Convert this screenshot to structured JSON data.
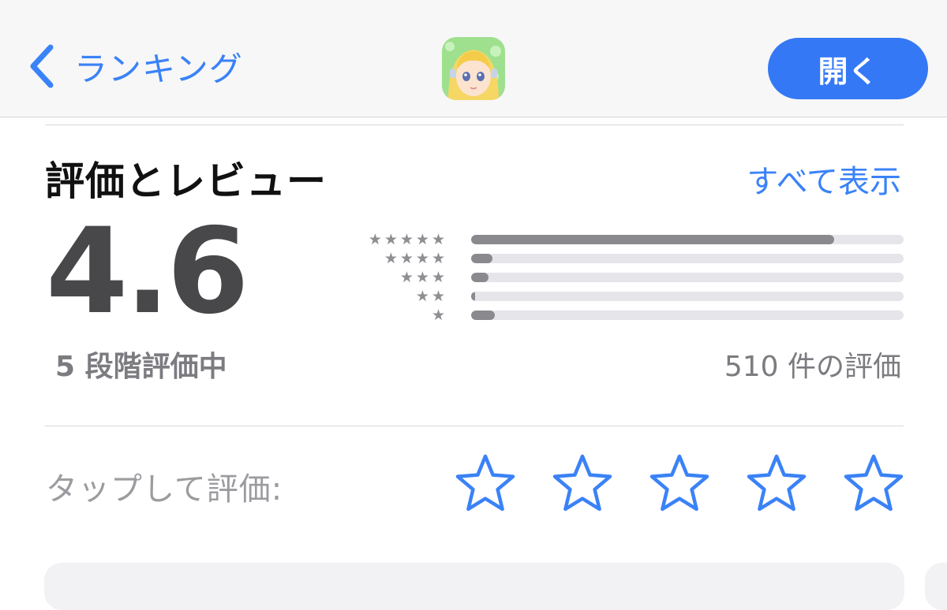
{
  "nav": {
    "back_label": "ランキング",
    "open_label": "開く"
  },
  "section": {
    "title": "評価とレビュー",
    "see_all": "すべて表示"
  },
  "rating": {
    "average": "4.6",
    "out_of": "5 段階評価中",
    "count_text": "510 件の評価",
    "histogram": [
      {
        "stars": "★★★★★",
        "fraction": 0.84
      },
      {
        "stars": "★★★★",
        "fraction": 0.05
      },
      {
        "stars": "★★★",
        "fraction": 0.04
      },
      {
        "stars": "★★",
        "fraction": 0.01
      },
      {
        "stars": "★",
        "fraction": 0.055
      }
    ]
  },
  "tap_to_rate": {
    "label": "タップして評価:",
    "star_count": 5
  },
  "colors": {
    "accent": "#3a82f7",
    "button": "#3478f6",
    "bar_fill": "#8a8a8e",
    "bar_track": "#e5e5ea",
    "score": "#48484a"
  },
  "icons": {
    "back": "chevron-left-icon",
    "app": "app-icon",
    "tap_star": "star-outline-icon"
  }
}
